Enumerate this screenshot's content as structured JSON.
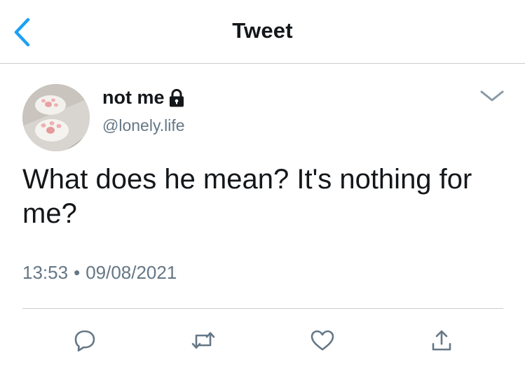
{
  "header": {
    "title": "Tweet",
    "back_icon": "chevron-left-icon",
    "accent": "#1da1f2"
  },
  "author": {
    "display_name": "not me",
    "handle": "@lonely.life",
    "protected_icon": "lock-icon",
    "avatar": "cat-paws-photo"
  },
  "tweet": {
    "text": "What does he mean? It's nothing for me?",
    "time": "13:53",
    "separator": "•",
    "date": "09/08/2021"
  },
  "actions": [
    {
      "icon": "reply-icon"
    },
    {
      "icon": "retweet-icon"
    },
    {
      "icon": "like-icon"
    },
    {
      "icon": "share-icon"
    }
  ],
  "colors": {
    "accent": "#1da1f2",
    "text": "#14171a",
    "secondary": "#657786",
    "icon": "#657786",
    "divider": "#c9cdd1"
  }
}
